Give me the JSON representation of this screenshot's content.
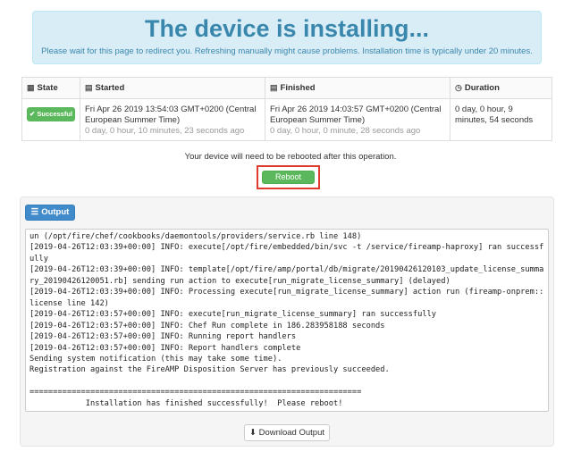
{
  "banner": {
    "title": "The device is installing...",
    "subtitle": "Please wait for this page to redirect you. Refreshing manually might cause problems. Installation time is typically under 20 minutes."
  },
  "table": {
    "headers": {
      "state": "State",
      "started": "Started",
      "finished": "Finished",
      "duration": "Duration"
    },
    "row": {
      "state": "Successful",
      "started": "Fri Apr 26 2019 13:54:03 GMT+0200 (Central European Summer Time)",
      "started_elapsed": "0 day, 0 hour, 10 minutes, 23 seconds ago",
      "finished": "Fri Apr 26 2019 14:03:57 GMT+0200 (Central European Summer Time)",
      "finished_elapsed": "0 day, 0 hour, 0 minute, 28 seconds ago",
      "duration": "0 day, 0 hour, 9 minutes, 54 seconds"
    }
  },
  "reboot": {
    "note": "Your device will need to be rebooted after this operation.",
    "button": "Reboot"
  },
  "output": {
    "button": "Output",
    "log": "un (/opt/fire/chef/cookbooks/daemontools/providers/service.rb line 148)\n[2019-04-26T12:03:39+00:00] INFO: execute[/opt/fire/embedded/bin/svc -t /service/fireamp-haproxy] ran successfully\n[2019-04-26T12:03:39+00:00] INFO: template[/opt/fire/amp/portal/db/migrate/20190426120103_update_license_summary_20190426120051.rb] sending run action to execute[run_migrate_license_summary] (delayed)\n[2019-04-26T12:03:39+00:00] INFO: Processing execute[run_migrate_license_summary] action run (fireamp-onprem::license line 142)\n[2019-04-26T12:03:57+00:00] INFO: execute[run_migrate_license_summary] ran successfully\n[2019-04-26T12:03:57+00:00] INFO: Chef Run complete in 186.283958188 seconds\n[2019-04-26T12:03:57+00:00] INFO: Running report handlers\n[2019-04-26T12:03:57+00:00] INFO: Report handlers complete\nSending system notification (this may take some time).\nRegistration against the FireAMP Disposition Server has previously succeeded.\n\n=======================================================================\n            Installation has finished successfully!  Please reboot!\n=======================================================================",
    "download_button": "Download Output"
  },
  "icons": {
    "state": "grid-icon",
    "started": "calendar-icon",
    "finished": "calendar-icon",
    "duration": "clock-icon",
    "success": "check-icon",
    "output": "list-icon",
    "download": "download-icon"
  },
  "colors": {
    "banner_bg": "#d9edf7",
    "banner_text": "#3a87ad",
    "success": "#5cb85c",
    "primary": "#428bca",
    "highlight": "#e03a2f"
  }
}
